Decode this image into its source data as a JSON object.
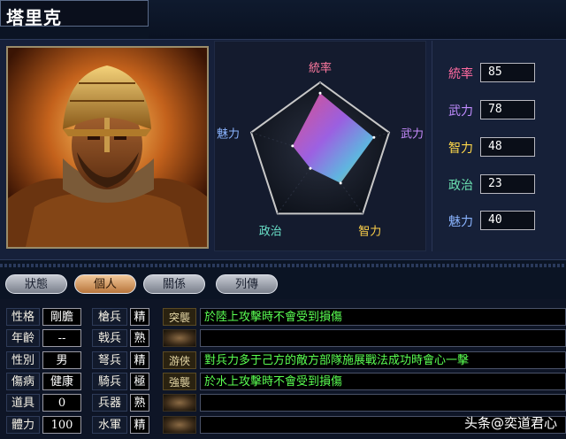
{
  "character": {
    "name": "塔里克"
  },
  "radar": {
    "labels": [
      "統率",
      "武力",
      "智力",
      "政治",
      "魅力"
    ],
    "values": [
      85,
      78,
      48,
      23,
      40
    ],
    "max": 100,
    "label_colors": [
      "#ff7aa0",
      "#c88cff",
      "#ffd24a",
      "#6ae0c8",
      "#8ab4ff"
    ]
  },
  "stats": [
    {
      "label": "統率",
      "value": "85",
      "color": "#ff6aa0"
    },
    {
      "label": "武力",
      "value": "78",
      "color": "#c08cff"
    },
    {
      "label": "智力",
      "value": "48",
      "color": "#ffd84a"
    },
    {
      "label": "政治",
      "value": "23",
      "color": "#6ae0b0"
    },
    {
      "label": "魅力",
      "value": "40",
      "color": "#8ab4ff"
    }
  ],
  "tabs": [
    {
      "label": "狀態",
      "active": false
    },
    {
      "label": "個人",
      "active": true
    },
    {
      "label": "關係",
      "active": false
    },
    {
      "label": "列傳",
      "active": false
    }
  ],
  "personal": {
    "rows": [
      {
        "label": "性格",
        "value": "剛膽"
      },
      {
        "label": "年齡",
        "value": "--"
      },
      {
        "label": "性別",
        "value": "男"
      },
      {
        "label": "傷病",
        "value": "健康"
      },
      {
        "label": "道具",
        "value": "0"
      },
      {
        "label": "體力",
        "value": "100"
      }
    ]
  },
  "troops": {
    "rows": [
      {
        "label": "槍兵",
        "value": "精"
      },
      {
        "label": "戟兵",
        "value": "熟"
      },
      {
        "label": "弩兵",
        "value": "精"
      },
      {
        "label": "騎兵",
        "value": "極"
      },
      {
        "label": "兵器",
        "value": "熟"
      },
      {
        "label": "水軍",
        "value": "精"
      }
    ]
  },
  "skills": [
    {
      "name": "突襲",
      "desc": "於陸上攻擊時不會受到損傷"
    },
    {
      "name": "",
      "desc": ""
    },
    {
      "name": "游俠",
      "desc": "對兵力多于己方的敵方部隊施展戰法成功時會心一擊"
    },
    {
      "name": "強襲",
      "desc": "於水上攻擊時不會受到損傷"
    },
    {
      "name": "",
      "desc": ""
    },
    {
      "name": "",
      "desc": ""
    }
  ],
  "watermark": "头条@奕道君心"
}
